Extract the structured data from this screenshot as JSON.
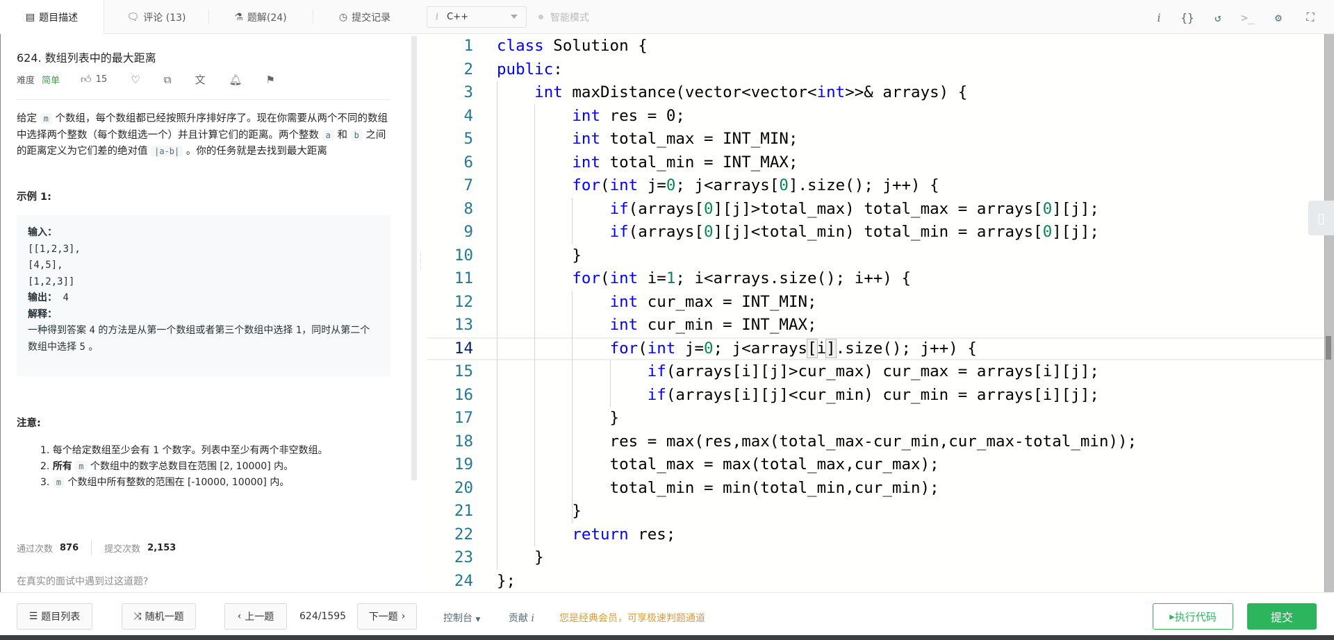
{
  "tabs": [
    {
      "label": "题目描述",
      "icon": "description-icon",
      "glyph": "▤"
    },
    {
      "label": "评论 (13)",
      "icon": "comment-icon",
      "glyph": "🗨"
    },
    {
      "label": "题解(24)",
      "icon": "flask-icon",
      "glyph": "⚗"
    },
    {
      "label": "提交记录",
      "icon": "clock-icon",
      "glyph": "◷"
    }
  ],
  "language": {
    "info": "i",
    "selected": "C++"
  },
  "smart_mode": "智能模式",
  "toolbar_icons": [
    {
      "name": "info-icon",
      "glyph": "i"
    },
    {
      "name": "format-braces-icon",
      "glyph": "{}"
    },
    {
      "name": "reset-icon",
      "glyph": "↺"
    },
    {
      "name": "terminal-icon",
      "glyph": ">_"
    },
    {
      "name": "settings-icon",
      "glyph": "⚙"
    },
    {
      "name": "fullscreen-icon",
      "glyph": "⛶"
    }
  ],
  "problem": {
    "title": "624. 数组列表中的最大距离",
    "difficulty_label": "难度",
    "difficulty": "简单",
    "likes": "15",
    "desc": [
      "给定 ",
      "m",
      " 个数组，每个数组都已经按照升序排好序了。现在你需要从两个不同的数组中选择两个整数（每个数组选一个）并且计算它们的距离。两个整数 ",
      "a",
      " 和 ",
      "b",
      " 之间的距离定义为它们差的绝对值 ",
      "|a-b|",
      " 。你的任务就是去找到最大距离"
    ],
    "example_heading": "示例 1:",
    "example": {
      "input_label": "输入：",
      "input_lines": [
        "[[1,2,3],",
        " [4,5],",
        " [1,2,3]]"
      ],
      "output_label": "输出：",
      "output": "4",
      "explain_label": "解释：",
      "explain": [
        "一种得到答案 ",
        "4",
        " 的方法是从第一个数组或者第三个数组中选择 ",
        "1",
        "，同时从第二个数组中选择 ",
        "5",
        " 。"
      ]
    },
    "note_heading": "注意:",
    "notes": [
      [
        "1. 每个给定数组至少会有 1 个数字。列表中至少有两个非空数组。"
      ],
      [
        "2. ",
        "所有",
        " ",
        "m",
        " 个数组中的数字总数目在范围 [2, 10000] 内。"
      ],
      [
        "3. ",
        "m",
        " 个数组中所有整数的范围在 [-10000, 10000] 内。"
      ]
    ],
    "accepted_label": "通过次数",
    "accepted": "876",
    "submissions_label": "提交次数",
    "submissions": "2,153",
    "interview_question": "在真实的面试中遇到过这道题?"
  },
  "code": {
    "current_line": 14,
    "lines": [
      "class Solution {",
      "public:",
      "    int maxDistance(vector<vector<int>>& arrays) {",
      "        int res = 0;",
      "        int total_max = INT_MIN;",
      "        int total_min = INT_MAX;",
      "        for(int j=0; j<arrays[0].size(); j++) {",
      "            if(arrays[0][j]>total_max) total_max = arrays[0][j];",
      "            if(arrays[0][j]<total_min) total_min = arrays[0][j];",
      "        }",
      "        for(int i=1; i<arrays.size(); i++) {",
      "            int cur_max = INT_MIN;",
      "            int cur_min = INT_MAX;",
      "            for(int j=0; j<arrays[i].size(); j++) {",
      "                if(arrays[i][j]>cur_max) cur_max = arrays[i][j];",
      "                if(arrays[i][j]<cur_min) cur_min = arrays[i][j];",
      "            }",
      "            res = max(res,max(total_max-cur_min,cur_max-total_min));",
      "            total_max = max(total_max,cur_max);",
      "            total_min = min(total_min,cur_min);",
      "        }",
      "        return res;",
      "    }",
      "};"
    ]
  },
  "bottom": {
    "problem_list": "题目列表",
    "random": "随机一题",
    "prev": "上一题",
    "page": "624/1595",
    "next": "下一题",
    "console": "控制台",
    "contribute": "贡献",
    "vip_message": "您是经典会员，可享极速判题通道",
    "run": "执行代码",
    "submit": "提交"
  },
  "colors": {
    "accent": "#2db55d",
    "keyword": "#0000ff",
    "number": "#098658",
    "line_number": "#237893",
    "vip": "#d49e3c"
  }
}
